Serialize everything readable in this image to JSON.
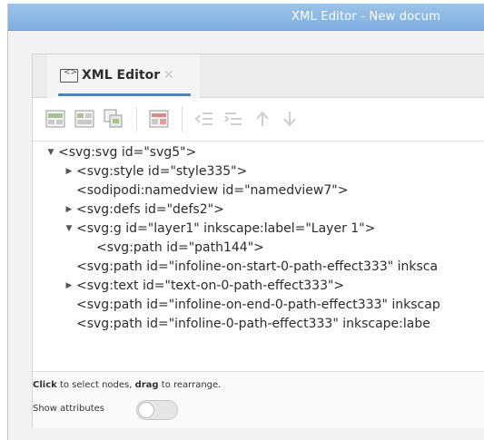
{
  "window": {
    "title": "XML Editor - New docum"
  },
  "tab": {
    "label": "XML Editor",
    "close_glyph": "✕",
    "icon": "xml-document-icon"
  },
  "toolbar": {
    "buttons": [
      {
        "name": "new-element-node-button",
        "icon": "new-element-icon",
        "enabled": true
      },
      {
        "name": "new-text-node-button",
        "icon": "new-text-icon",
        "enabled": true
      },
      {
        "name": "duplicate-node-button",
        "icon": "duplicate-icon",
        "enabled": true
      },
      {
        "name": "delete-node-button",
        "icon": "delete-node-icon",
        "enabled": true
      },
      {
        "name": "unindent-node-button",
        "icon": "unindent-icon",
        "enabled": false
      },
      {
        "name": "indent-node-button",
        "icon": "indent-icon",
        "enabled": false
      },
      {
        "name": "raise-node-button",
        "icon": "arrow-up-icon",
        "enabled": false
      },
      {
        "name": "lower-node-button",
        "icon": "arrow-down-icon",
        "enabled": false
      }
    ]
  },
  "tree": {
    "nodes": [
      {
        "text": "<svg:svg id=\"svg5\">",
        "arrow": "▼"
      },
      {
        "text": "<svg:style id=\"style335\">",
        "arrow": "▶"
      },
      {
        "text": "<sodipodi:namedview id=\"namedview7\">",
        "arrow": ""
      },
      {
        "text": "<svg:defs id=\"defs2\">",
        "arrow": "▶"
      },
      {
        "text": "<svg:g id=\"layer1\" inkscape:label=\"Layer 1\">",
        "arrow": "▼"
      },
      {
        "text": "<svg:path id=\"path144\">",
        "arrow": ""
      },
      {
        "text": "<svg:path id=\"infoline-on-start-0-path-effect333\" inksca",
        "arrow": ""
      },
      {
        "text": "<svg:text id=\"text-on-0-path-effect333\">",
        "arrow": "▶"
      },
      {
        "text": "<svg:path id=\"infoline-on-end-0-path-effect333\" inkscap",
        "arrow": ""
      },
      {
        "text": "<svg:path id=\"infoline-0-path-effect333\" inkscape:labe",
        "arrow": ""
      }
    ]
  },
  "footer": {
    "hint_click": "Click",
    "hint_mid": " to select nodes, ",
    "hint_drag": "drag",
    "hint_end": " to rearrange.",
    "show_attributes_label": "Show attributes",
    "show_attributes_on": false
  },
  "colors": {
    "accent": "#3d86d6",
    "titlebar": "#8db9e6"
  }
}
